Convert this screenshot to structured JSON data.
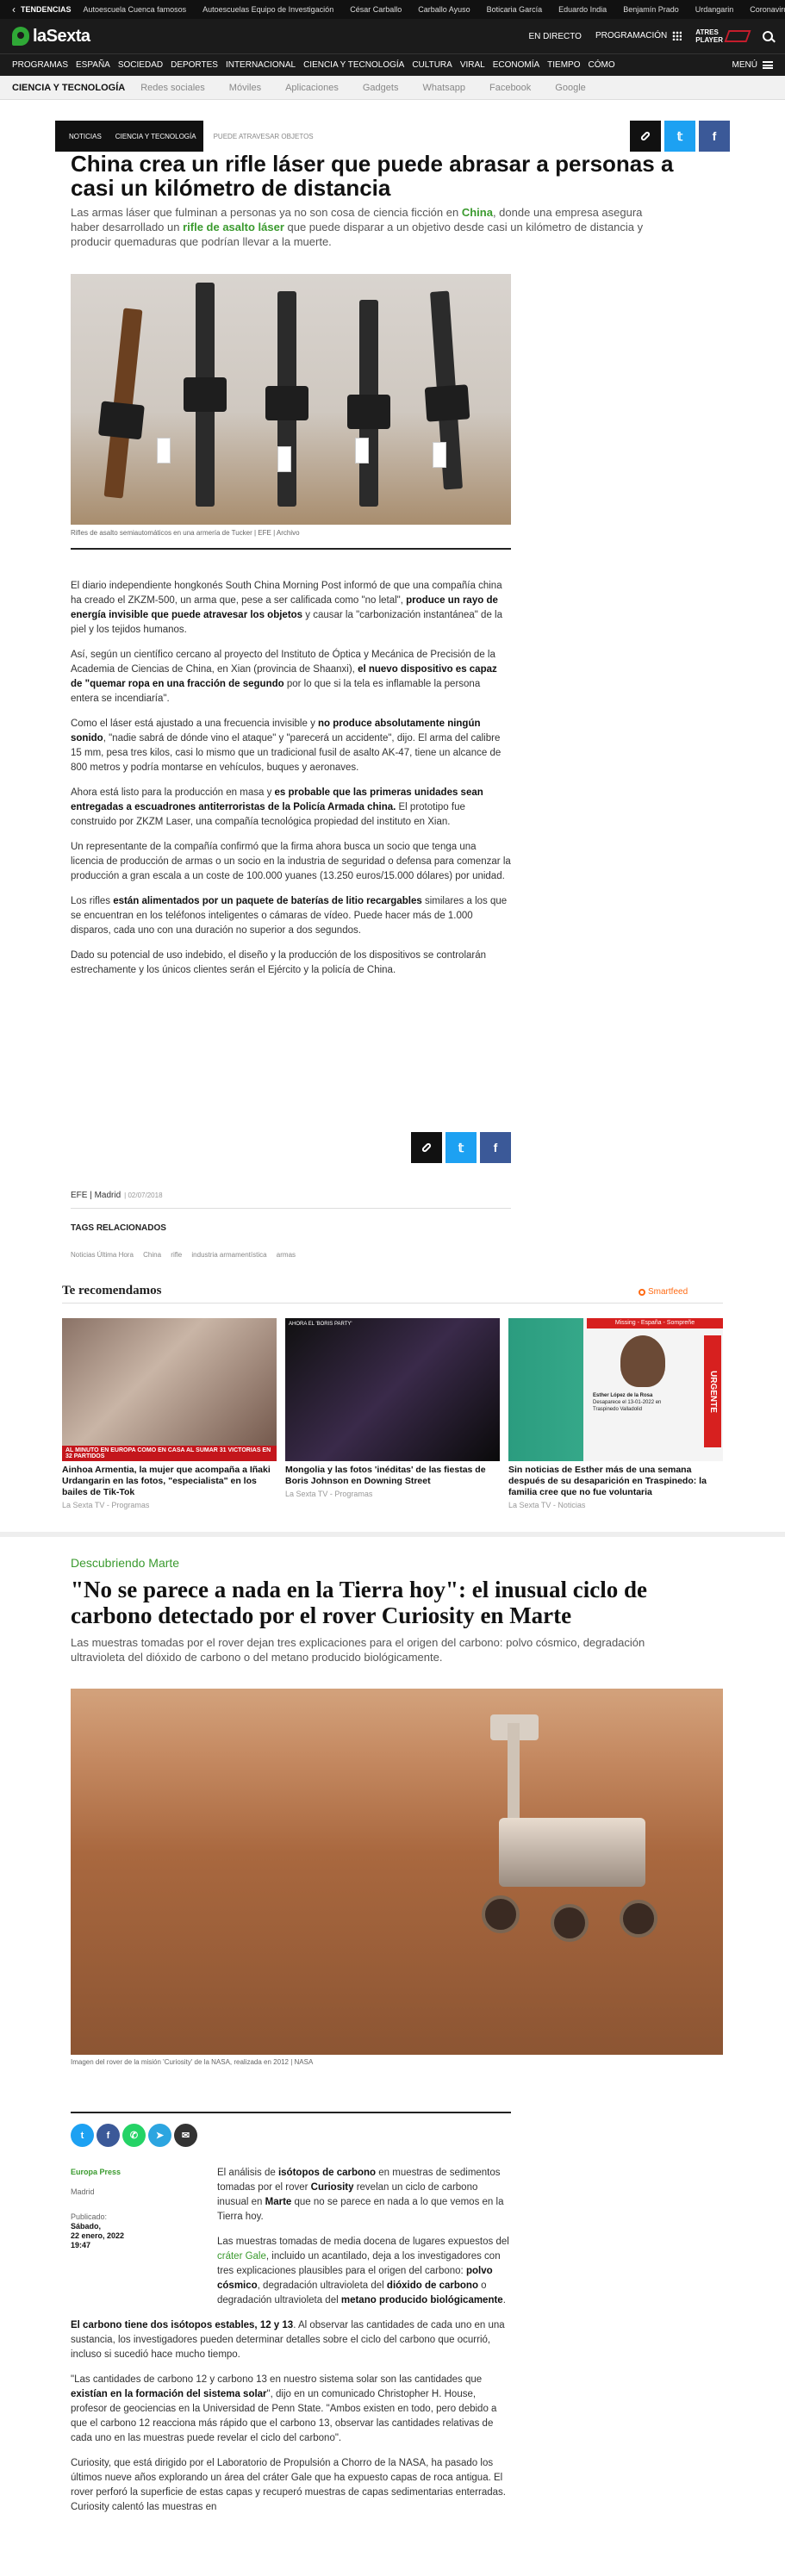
{
  "trending": {
    "title": "TENDENCIAS",
    "items": [
      "Autoescuela Cuenca famosos",
      "Autoescuelas Equipo de Investigación",
      "César Carballo",
      "Carballo Ayuso",
      "Boticaria García",
      "Eduardo India",
      "Benjamín Prado",
      "Urdangarin",
      "Coronavirus España"
    ]
  },
  "brand": {
    "name": "laSexta",
    "live": "EN DIRECTO",
    "programming": "PROGRAMACIÓN",
    "group_line1": "ATRES",
    "group_line2": "PLAYER"
  },
  "main_nav": {
    "items": [
      "PROGRAMAS",
      "ESPAÑA",
      "SOCIEDAD",
      "DEPORTES",
      "INTERNACIONAL",
      "CIENCIA Y TECNOLOGÍA",
      "CULTURA",
      "VIRAL",
      "ECONOMÍA",
      "TIEMPO",
      "CÓMO"
    ],
    "menu_label": "MENÚ"
  },
  "section_nav": {
    "current": "CIENCIA Y TECNOLOGÍA",
    "items": [
      "Redes sociales",
      "Móviles",
      "Aplicaciones",
      "Gadgets",
      "Whatsapp",
      "Facebook",
      "Google"
    ]
  },
  "article1": {
    "chips": [
      "NOTICIAS",
      "CIENCIA Y TECNOLOGÍA"
    ],
    "chip_extra": "PUEDE ATRAVESAR OBJETOS",
    "title": "China crea un rifle láser que puede abrasar a personas a casi un kilómetro de distancia",
    "lead_1": "Las armas láser que fulminan a personas ya no son cosa de ciencia ficción en ",
    "lead_link1": "China",
    "lead_2": ", donde una empresa asegura haber desarrollado un ",
    "lead_link2": "rifle de asalto láser",
    "lead_3": " que puede disparar a un objetivo desde casi un kilómetro de distancia y producir quemaduras que podrían llevar a la muerte.",
    "image_caption": "Rifles de asalto semiautomáticos en una armería de Tucker | EFE | Archivo",
    "paragraphs": [
      {
        "a": "El diario independiente hongkonés South China Morning Post informó de que una compañía china ha creado el ZKZM-500, un arma que, pese a ser calificada como \"no letal\", ",
        "b": "produce un rayo de energía invisible que puede atravesar los objetos",
        "c": " y causar la \"carbonización instantánea\" de la piel y los tejidos humanos."
      },
      {
        "a": "Así, según un científico cercano al proyecto del Instituto de Óptica y Mecánica de Precisión de la Academia de Ciencias de China, en Xian (provincia de Shaanxi), ",
        "b": "el nuevo dispositivo es capaz de \"quemar ropa en una fracción de segundo",
        "c": " por lo que si la tela es inflamable la persona entera se incendiaría\"."
      },
      {
        "a": "Como el láser está ajustado a una frecuencia invisible y ",
        "b": "no produce absolutamente ningún sonido",
        "c": ", \"nadie sabrá de dónde vino el ataque\" y \"parecerá un accidente\", dijo. El arma del calibre 15 mm, pesa tres kilos, casi lo mismo que un tradicional fusil de asalto AK-47, tiene un alcance de 800 metros y podría montarse en vehículos, buques y aeronaves."
      },
      {
        "a": "Ahora está listo para la producción en masa y ",
        "b": "es probable que las primeras unidades sean entregadas a escuadrones antiterroristas de la Policía Armada china.",
        "c": " El prototipo fue construido por ZKZM Laser, una compañía tecnológica propiedad del instituto en Xian."
      },
      {
        "a": "Un representante de la compañía confirmó que la firma ahora busca un socio que tenga una licencia de producción de armas o un socio en la industria de seguridad o defensa para comenzar la producción a gran escala a un coste de 100.000 yuanes (13.250 euros/15.000 dólares) por unidad.",
        "b": "",
        "c": ""
      },
      {
        "a": "Los rifles ",
        "b": "están alimentados por un paquete de baterías de litio recargables",
        "c": " similares a los que se encuentran en los teléfonos inteligentes o cámaras de vídeo. Puede hacer más de 1.000 disparos, cada uno con una duración no superior a dos segundos."
      },
      {
        "a": "Dado su potencial de uso indebido, el diseño y la producción de los dispositivos se controlarán estrechamente y los únicos clientes serán el Ejército y la policía de China.",
        "b": "",
        "c": ""
      }
    ],
    "source": "EFE | Madrid",
    "date": "| 02/07/2018",
    "tags_title": "TAGS RELACIONADOS",
    "tags": [
      "Noticias Última Hora",
      "China",
      "rifle",
      "industria armamentística",
      "armas"
    ]
  },
  "recommend": {
    "title": "Te recomendamos",
    "smartfeed": "Smartfeed",
    "cards": [
      {
        "title": "Ainhoa Armentia, la mujer que acompaña a Iñaki Urdangarin en las fotos, \"especialista\" en los bailes de Tik-Tok",
        "source": "La Sexta TV - Programas",
        "overlay": "AL MINUTO EN EUROPA COMO EN CASA AL SUMAR 31 VICTORIAS EN 32 PARTIDOS"
      },
      {
        "title": "Mongolia y las fotos 'inéditas' de las fiestas de Boris Johnson en Downing Street",
        "source": "La Sexta TV - Programas",
        "overlay": "AHORA EL 'BORIS PARTY'"
      },
      {
        "title": "Sin noticias de Esther más de una semana después de su desaparición en Traspinedo: la familia cree que no fue voluntaria",
        "source": "La Sexta TV - Noticias",
        "urgent": "URGENTE",
        "head": "Missing - España - Sompreñe",
        "person": "Esther López de la Rosa",
        "ptext": "Desaparece el 13-01-2022 en Traspinedo Valladolid"
      }
    ]
  },
  "article2": {
    "kicker": "Descubriendo Marte",
    "title": "\"No se parece a nada en la Tierra hoy\": el inusual ciclo de carbono detectado por el rover Curiosity en Marte",
    "lead": "Las muestras tomadas por el rover dejan tres explicaciones para el origen del carbono: polvo cósmico, degradación ultravioleta del dióxido de carbono o del metano producido biológicamente.",
    "image_caption": "Imagen del rover de la misión 'Curiosity' de la NASA, realizada en 2012 | NASA",
    "source": "Europa Press",
    "city": "Madrid",
    "published_label": "Publicado:",
    "published_day": "Sábado,",
    "published_date": "22 enero, 2022",
    "published_time": "19:47",
    "paragraphs": [
      {
        "a": "El análisis de ",
        "b": "isótopos de carbono",
        "c": " en muestras de sedimentos tomadas por el rover ",
        "d": "Curiosity",
        "e": " revelan un ciclo de carbono inusual en ",
        "f": "Marte",
        "g": " que no se parece en nada a lo que vemos en la Tierra hoy."
      },
      {
        "a": "Las muestras tomadas de media docena de lugares expuestos del ",
        "b": "cráter Gale",
        "c": ", incluido un acantilado, deja a los investigadores con tres explicaciones plausibles para el origen del carbono: ",
        "d": "polvo cósmico",
        "e": ", degradación ultravioleta del ",
        "f": "dióxido de carbono",
        "g": " o degradación ultravioleta del ",
        "h": "metano producido biológicamente",
        "i": "."
      },
      {
        "a": "El carbono tiene dos isótopos estables, 12 y 13",
        "b": ". Al observar las cantidades de cada uno en una sustancia, los investigadores pueden determinar detalles sobre el ciclo del carbono que ocurrió, incluso si sucedió hace mucho tiempo."
      },
      {
        "a": "\"Las cantidades de carbono 12 y carbono 13 en nuestro sistema solar son las cantidades que ",
        "b": "existían en la formación del sistema solar",
        "c": "\", dijo en un comunicado Christopher H. House, profesor de geociencias en la Universidad de Penn State. \"Ambos existen en todo, pero debido a que el carbono 12 reacciona más rápido que el carbono 13, observar las cantidades relativas de cada uno en las muestras puede revelar el ciclo del carbono\"."
      },
      {
        "a": "Curiosity, que está dirigido por el Laboratorio de Propulsión a Chorro de la NASA, ha pasado los últimos nueve años explorando un área del cráter Gale que ha expuesto capas de roca antigua. El rover perforó la superficie de estas capas y recuperó muestras de capas sedimentarias enterradas. Curiosity calentó las muestras en"
      }
    ]
  }
}
